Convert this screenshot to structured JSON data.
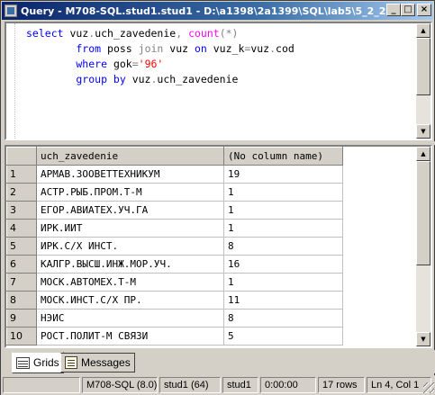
{
  "window": {
    "title": "Query - M708-SQL.stud1.stud1 - D:\\a1398\\2a1399\\SQL\\lab5\\5_2_2.sql",
    "minimize": "_",
    "maximize": "□",
    "close": "×"
  },
  "editor": {
    "lines": [
      [
        {
          "t": "select ",
          "c": "kw"
        },
        {
          "t": "vuz",
          "c": "txt"
        },
        {
          "t": ".",
          "c": "op"
        },
        {
          "t": "uch_zavedenie",
          "c": "txt"
        },
        {
          "t": ", ",
          "c": "op"
        },
        {
          "t": "count",
          "c": "fn"
        },
        {
          "t": "(*)",
          "c": "op"
        }
      ],
      [
        {
          "t": "        from ",
          "c": "kw"
        },
        {
          "t": "poss ",
          "c": "txt"
        },
        {
          "t": "join ",
          "c": "op"
        },
        {
          "t": "vuz ",
          "c": "txt"
        },
        {
          "t": "on ",
          "c": "kw"
        },
        {
          "t": "vuz_k",
          "c": "txt"
        },
        {
          "t": "=",
          "c": "op"
        },
        {
          "t": "vuz",
          "c": "txt"
        },
        {
          "t": ".",
          "c": "op"
        },
        {
          "t": "cod",
          "c": "txt"
        }
      ],
      [
        {
          "t": "        where ",
          "c": "kw"
        },
        {
          "t": "gok",
          "c": "txt"
        },
        {
          "t": "=",
          "c": "op"
        },
        {
          "t": "'96'",
          "c": "str"
        }
      ],
      [
        {
          "t": "        group by ",
          "c": "kw"
        },
        {
          "t": "vuz",
          "c": "txt"
        },
        {
          "t": ".",
          "c": "op"
        },
        {
          "t": "uch_zavedenie",
          "c": "txt"
        }
      ]
    ]
  },
  "grid": {
    "columns": [
      "uch_zavedenie",
      "(No column name)"
    ],
    "rows": [
      [
        "1",
        "АРМАВ.ЗООВЕТТЕХНИКУМ",
        "19"
      ],
      [
        "2",
        "АСТР.РЫБ.ПРОМ.Т-М",
        "1"
      ],
      [
        "3",
        "ЕГОР.АВИАТЕХ.УЧ.ГА",
        "1"
      ],
      [
        "4",
        "ИРК.ИИТ",
        "1"
      ],
      [
        "5",
        "ИРК.С/Х ИНСТ.",
        "8"
      ],
      [
        "6",
        "КАЛГР.ВЫСШ.ИНЖ.МОР.УЧ.",
        "16"
      ],
      [
        "7",
        "МОСК.АВТОМЕХ.Т-М",
        "1"
      ],
      [
        "8",
        "МОСК.ИНСТ.С/Х ПР.",
        "11"
      ],
      [
        "9",
        "НЭИС",
        "8"
      ],
      [
        "10",
        "РОСТ.ПОЛИТ-М СВЯЗИ",
        "5"
      ]
    ]
  },
  "tabs": {
    "grids": "Grids",
    "messages": "Messages"
  },
  "status": {
    "server": "M708-SQL (8.0)",
    "connection": "stud1 (64)",
    "database": "stud1",
    "elapsed": "0:00:00",
    "rows": "17 rows",
    "position": "Ln 4, Col 1"
  }
}
